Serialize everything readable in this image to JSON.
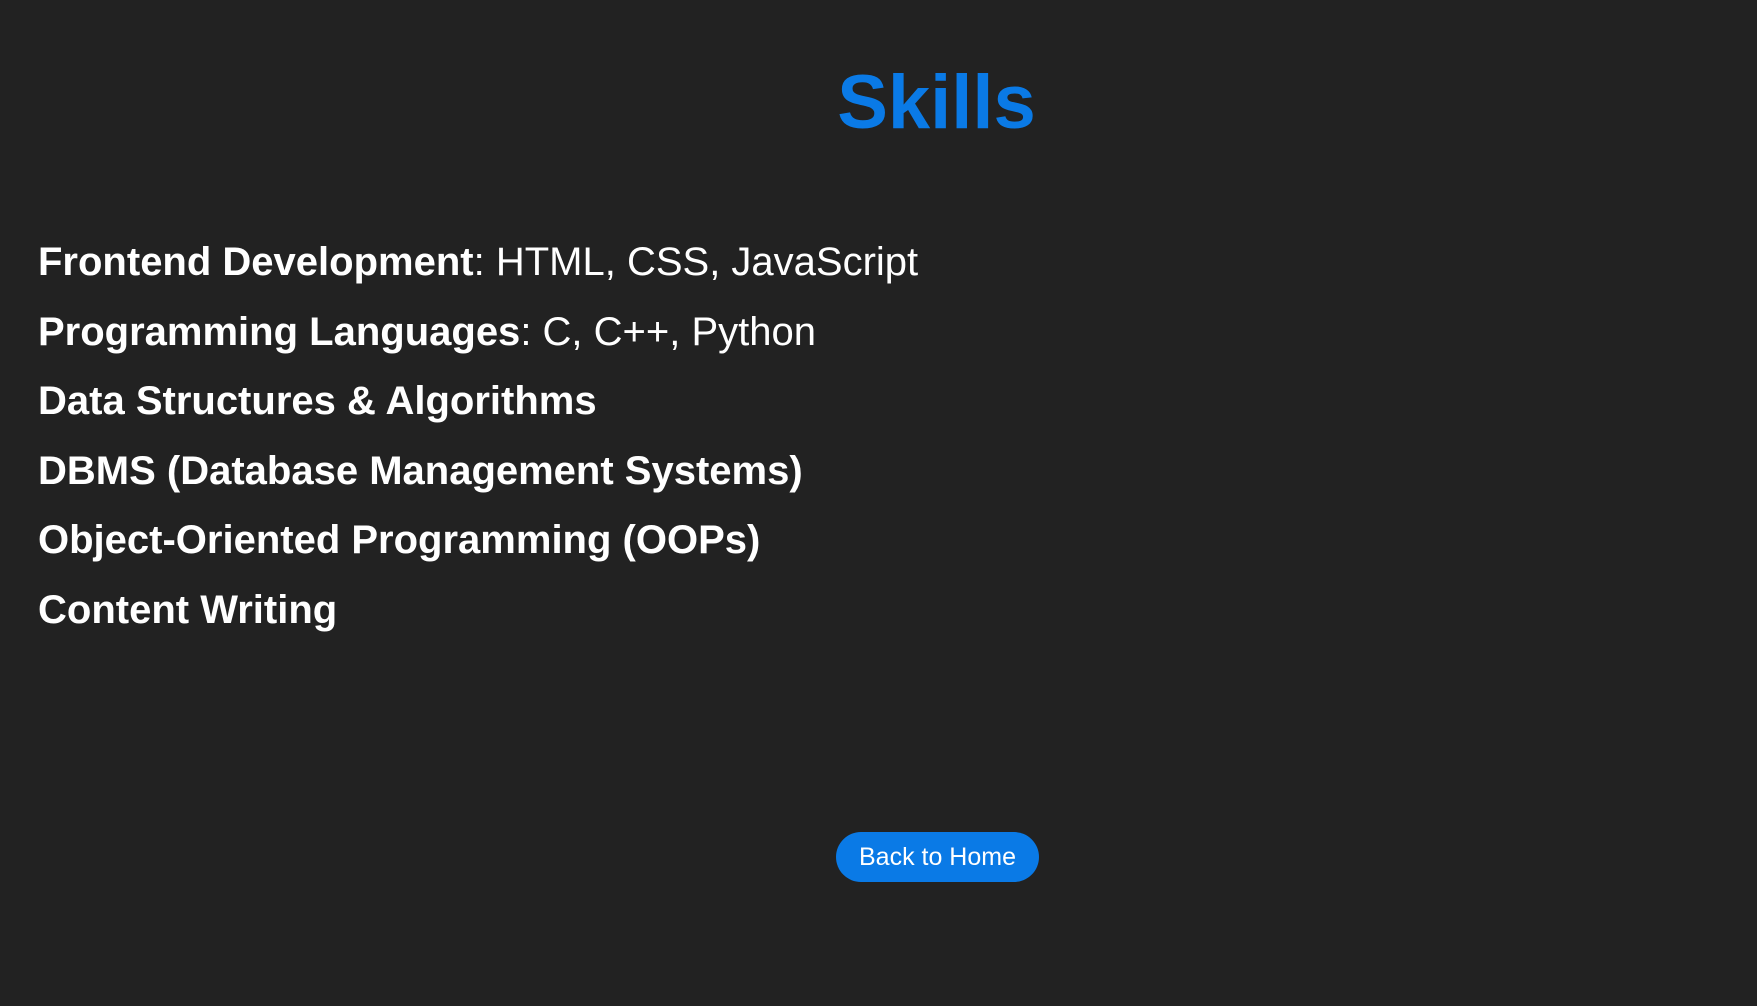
{
  "page": {
    "title": "Skills"
  },
  "skills": [
    {
      "name": "Frontend Development",
      "separator": ": ",
      "detail": "HTML, CSS, JavaScript"
    },
    {
      "name": "Programming Languages",
      "separator": ": ",
      "detail": "C, C++, Python"
    },
    {
      "name": "Data Structures & Algorithms",
      "separator": "",
      "detail": ""
    },
    {
      "name": "DBMS (Database Management Systems)",
      "separator": "",
      "detail": ""
    },
    {
      "name": "Object-Oriented Programming (OOPs)",
      "separator": "",
      "detail": ""
    },
    {
      "name": "Content Writing",
      "separator": "",
      "detail": ""
    }
  ],
  "nav": {
    "back_label": "Back to Home"
  },
  "colors": {
    "background": "#222222",
    "accent": "#0a7ae6",
    "text": "#ffffff"
  }
}
